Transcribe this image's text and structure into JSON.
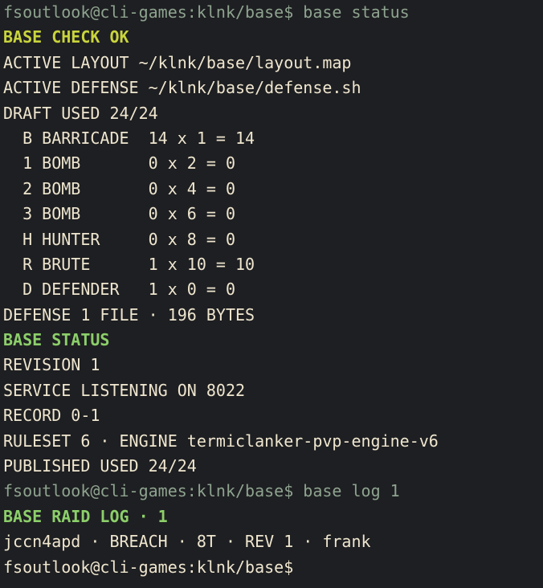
{
  "session": {
    "prompt": "fsoutlook@cli-games:klnk/base$",
    "command_1": " base status",
    "command_2": " base log 1"
  },
  "status": {
    "check": "BASE CHECK OK",
    "active_layout": "ACTIVE LAYOUT ~/klnk/base/layout.map",
    "active_defense": "ACTIVE DEFENSE ~/klnk/base/defense.sh",
    "draft_used": "DRAFT USED 24/24",
    "draft_items": [
      "  B BARRICADE  14 x 1 = 14",
      "  1 BOMB       0 x 2 = 0",
      "  2 BOMB       0 x 4 = 0",
      "  3 BOMB       0 x 6 = 0",
      "  H HUNTER     0 x 8 = 0",
      "  R BRUTE      1 x 10 = 10",
      "  D DEFENDER   1 x 0 = 0"
    ],
    "defense_files": "DEFENSE 1 FILE · 196 BYTES",
    "section_title": "BASE STATUS",
    "revision": "REVISION 1",
    "service": "SERVICE LISTENING ON 8022",
    "record": "RECORD 0-1",
    "ruleset": "RULESET 6 · ENGINE termiclanker-pvp-engine-v6",
    "published_used": "PUBLISHED USED 24/24"
  },
  "raid_log": {
    "title": "BASE RAID LOG · 1",
    "entries": [
      "jccn4apd · BREACH · 8T · REV 1 · frank"
    ]
  },
  "colors": {
    "background": "#1e1f22",
    "prompt": "#8ea38f",
    "text": "#efe6cf",
    "heading_yellow": "#c9d43c",
    "heading_green": "#8ccf6a"
  }
}
